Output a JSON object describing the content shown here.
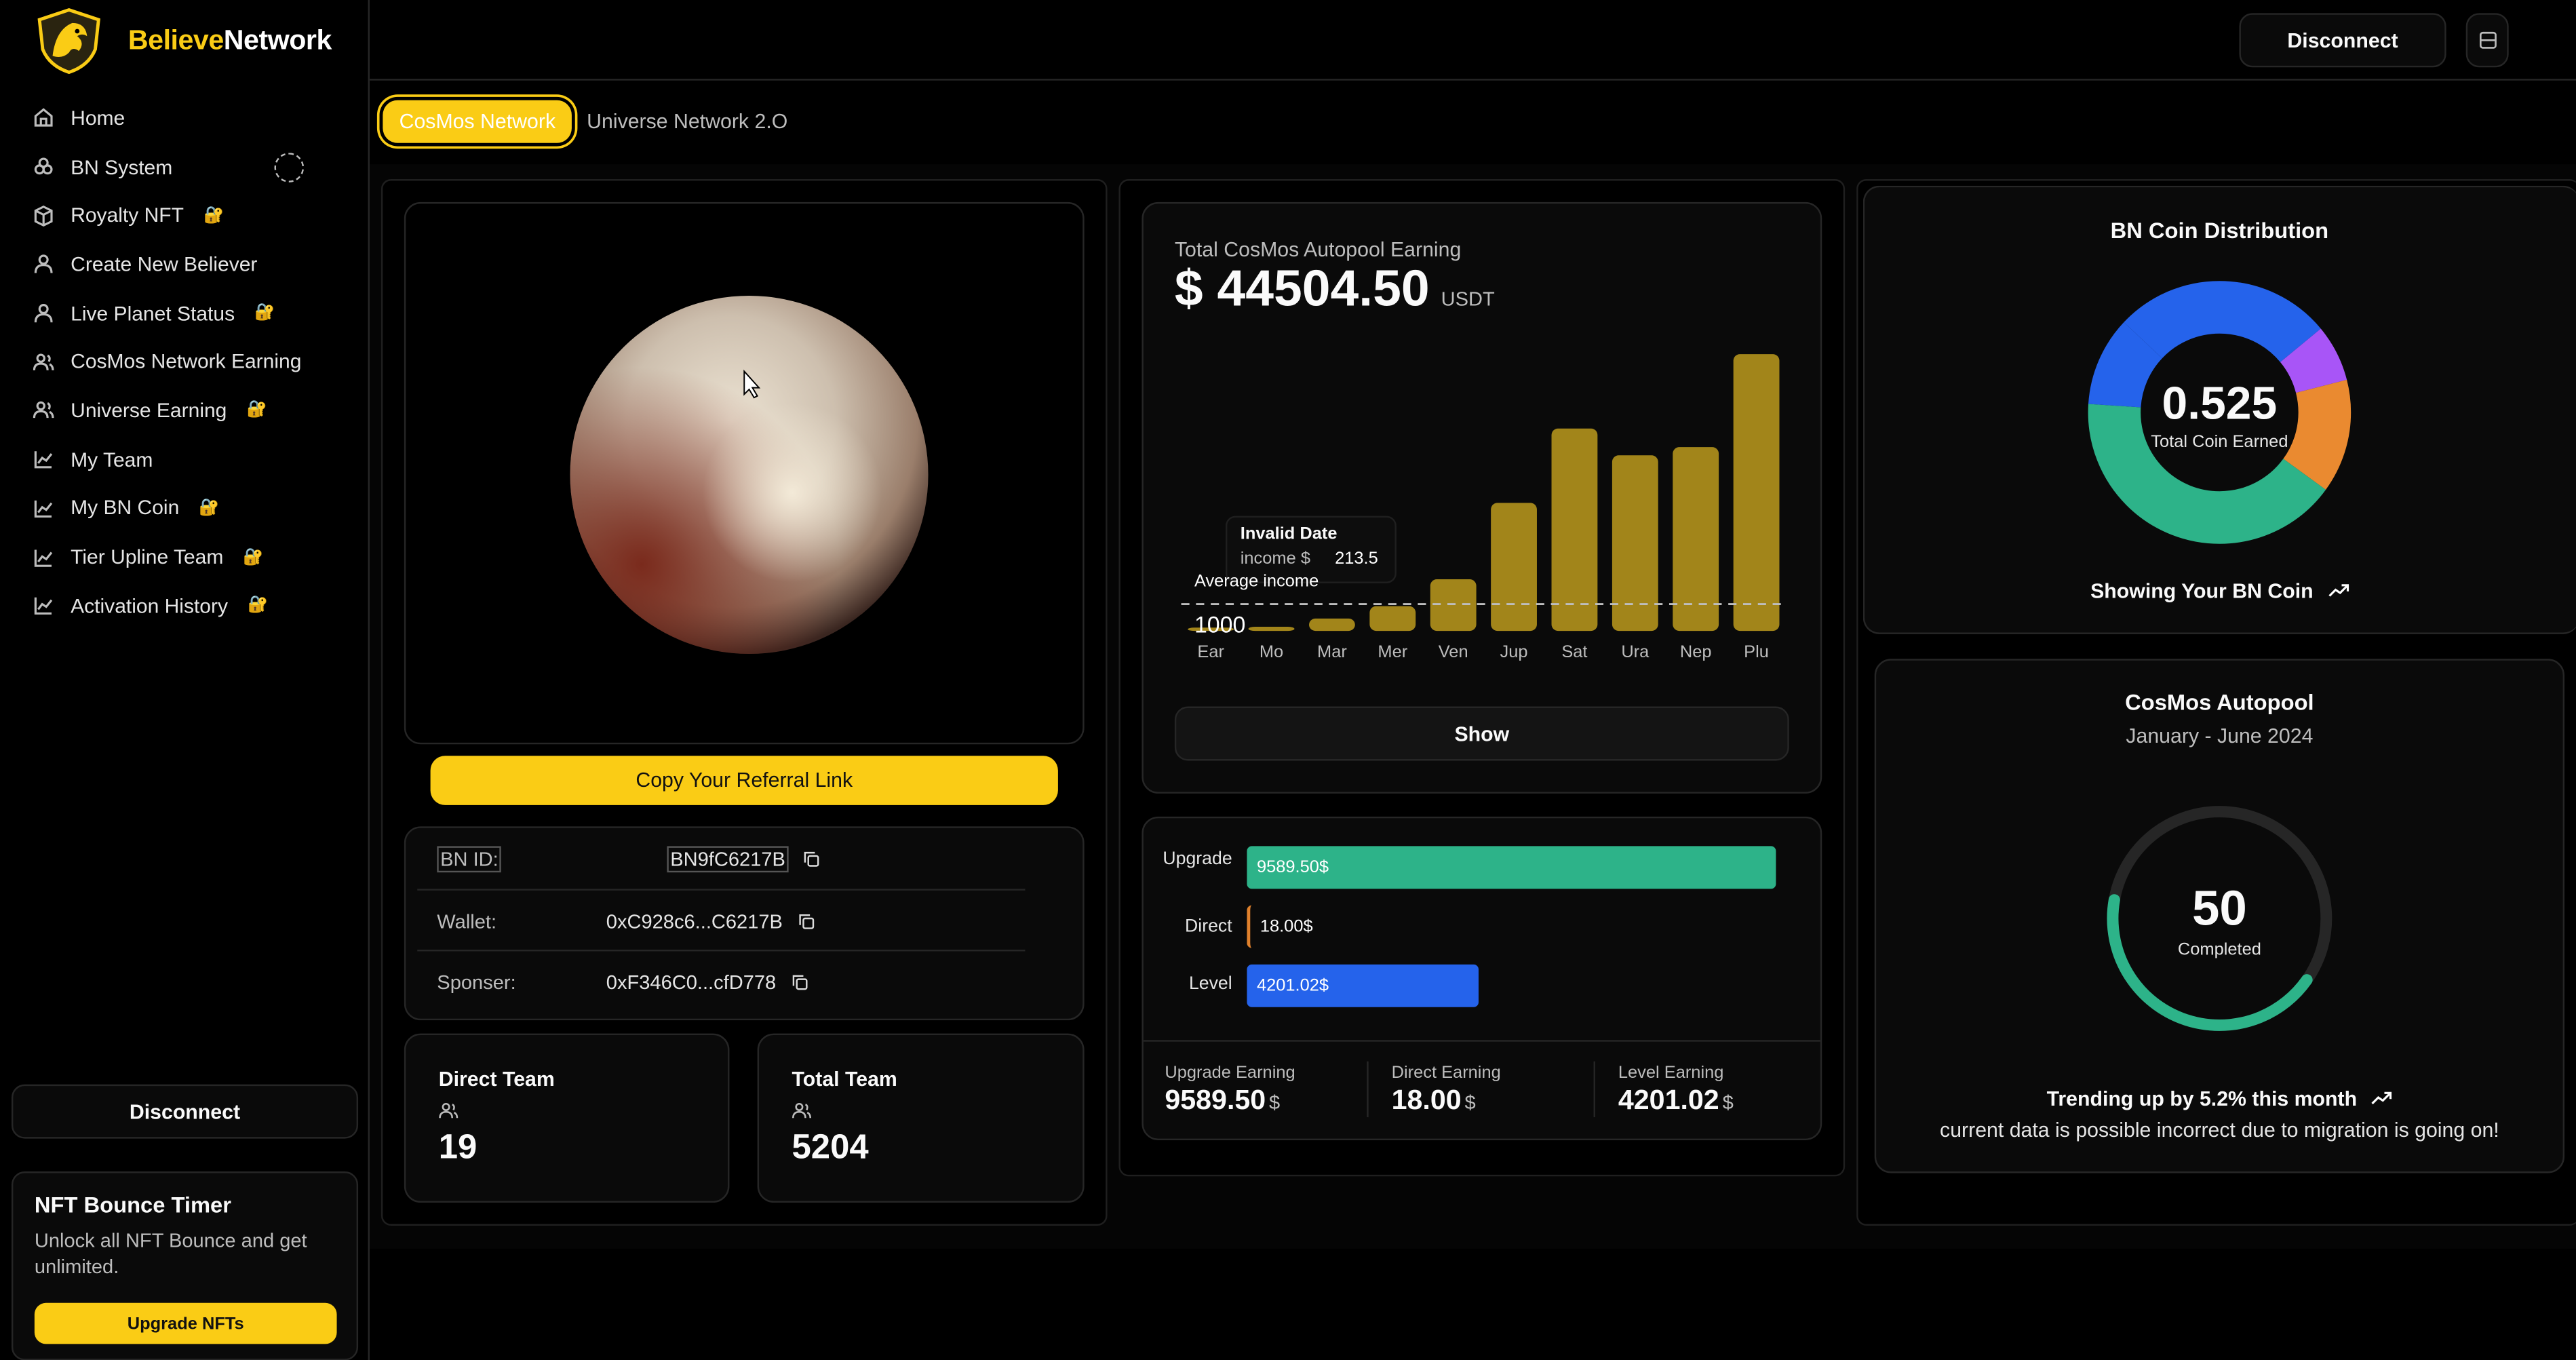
{
  "brand": {
    "name_part1": "Believe",
    "name_part2": "Network"
  },
  "sidebar": {
    "items": [
      {
        "label": "Home",
        "icon": "home-icon",
        "locked": false
      },
      {
        "label": "BN System",
        "icon": "coins-icon",
        "locked": false
      },
      {
        "label": "Royalty NFT",
        "icon": "box-icon",
        "locked": true
      },
      {
        "label": "Create New Believer",
        "icon": "user-icon",
        "locked": false
      },
      {
        "label": "Live Planet Status",
        "icon": "user-icon",
        "locked": true
      },
      {
        "label": "CosMos Network Earning",
        "icon": "users-icon",
        "locked": false
      },
      {
        "label": "Universe Earning",
        "icon": "users-icon",
        "locked": true
      },
      {
        "label": "My Team",
        "icon": "chart-line-icon",
        "locked": false
      },
      {
        "label": "My BN Coin",
        "icon": "chart-line-icon",
        "locked": true
      },
      {
        "label": "Tier Upline Team",
        "icon": "chart-line-icon",
        "locked": true
      },
      {
        "label": "Activation History",
        "icon": "chart-line-icon",
        "locked": true
      }
    ],
    "lock_glyph": "🔐",
    "disconnect_label": "Disconnect",
    "nft": {
      "title": "NFT Bounce Timer",
      "description": "Unlock all NFT Bounce and get unlimited.",
      "button": "Upgrade NFTs"
    }
  },
  "header": {
    "disconnect_label": "Disconnect"
  },
  "tabs": {
    "active": "CosMos Network",
    "inactive": "Universe Network 2.O"
  },
  "referral": {
    "copy_label": "Copy Your Referral Link"
  },
  "account": {
    "bn_id_label": "BN ID:",
    "bn_id": "BN9fC6217B",
    "wallet_label": "Wallet:",
    "wallet": "0xC928c6...C6217B",
    "sponsor_label": "Sponser:",
    "sponsor": "0xF346C0...cfD778"
  },
  "team": {
    "direct_label": "Direct Team",
    "direct_value": "19",
    "total_label": "Total Team",
    "total_value": "5204"
  },
  "earning_chart": {
    "title": "Total CosMos Autopool Earning",
    "amount": "$ 44504.50",
    "unit": "USDT",
    "avg_label": "Average income",
    "tooltip_title": "Invalid Date",
    "tooltip_label": "income $",
    "tooltip_value": "213.5",
    "overlay_value": "1000",
    "show_label": "Show"
  },
  "chart_data": {
    "type": "bar",
    "categories": [
      "Ear",
      "Mo",
      "Mar",
      "Mer",
      "Ven",
      "Jup",
      "Sat",
      "Ura",
      "Nep",
      "Plu"
    ],
    "values": [
      10,
      20,
      60,
      120,
      250,
      620,
      980,
      850,
      890,
      1340
    ],
    "average_line": 130,
    "ylim": [
      0,
      1400
    ],
    "bar_color": "#a2851a"
  },
  "breakdown": {
    "upgrade_label": "Upgrade",
    "upgrade_value": "9589.50$",
    "upgrade_fraction": 1.0,
    "upgrade_color": "#2db389",
    "direct_label": "Direct",
    "direct_value": "18.00$",
    "direct_fraction": 0.002,
    "direct_color": "#e0812c",
    "level_label": "Level",
    "level_value": "4201.02$",
    "level_fraction": 0.438,
    "level_color": "#2563eb",
    "upgrade_earning_label": "Upgrade Earning",
    "upgrade_earning": "9589.50",
    "direct_earning_label": "Direct Earning",
    "direct_earning": "18.00",
    "level_earning_label": "Level Earning",
    "level_earning": "4201.02",
    "currency": "$"
  },
  "distribution": {
    "title": "BN Coin Distribution",
    "value": "0.525",
    "sub": "Total Coin Earned",
    "footer": "Showing Your BN Coin",
    "slices": [
      {
        "color": "#2563eb",
        "fraction": 0.27
      },
      {
        "color": "#a855f7",
        "fraction": 0.07
      },
      {
        "color": "#ea8a30",
        "fraction": 0.14
      },
      {
        "color": "#2db389",
        "fraction": 0.41
      },
      {
        "color": "#2563eb",
        "fraction": 0.11
      }
    ]
  },
  "autopool": {
    "title": "CosMos Autopool",
    "period": "January - June 2024",
    "value": "50",
    "value_label": "Completed",
    "progress_fraction": 0.43,
    "trend": "Trending up by 5.2% this month",
    "note": "current data is possible incorrect due to migration is going on!"
  }
}
